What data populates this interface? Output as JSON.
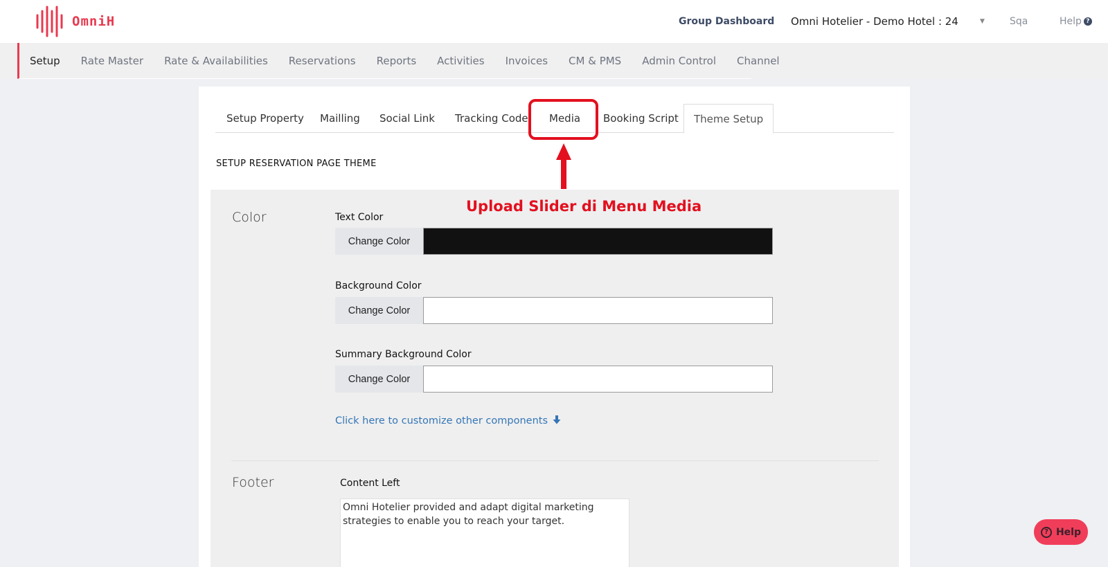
{
  "header": {
    "logo_text": "OmniH",
    "group_dashboard": "Group Dashboard",
    "hotel_selector": "Omni Hotelier - Demo Hotel : 24",
    "caret": "▼",
    "user": "Sqa",
    "help": "Help",
    "help_icon": "question-circle-icon"
  },
  "mainnav": {
    "items": [
      "Setup",
      "Rate Master",
      "Rate & Availabilities",
      "Reservations",
      "Reports",
      "Activities",
      "Invoices",
      "CM & PMS",
      "Admin Control",
      "Channel"
    ],
    "active": "Setup"
  },
  "tabs": {
    "items": [
      "Setup Property",
      "Mailling",
      "Social Link",
      "Tracking Code",
      "Media",
      "Booking Script",
      "Theme Setup"
    ],
    "active": "Theme Setup"
  },
  "page": {
    "section_title": "SETUP RESERVATION PAGE THEME"
  },
  "color_section": {
    "label": "Color",
    "fields": [
      {
        "label": "Text Color",
        "button": "Change Color",
        "value_color": "#111111"
      },
      {
        "label": "Background Color",
        "button": "Change Color",
        "value_color": "#ffffff"
      },
      {
        "label": "Summary Background Color",
        "button": "Change Color",
        "value_color": "#ffffff"
      }
    ],
    "customize_link": "Click here to customize other components",
    "customize_icon": "arrow-down-icon"
  },
  "footer_section": {
    "label": "Footer",
    "content_left_label": "Content Left",
    "content_left_value": "Omni Hotelier provided and adapt digital marketing strategies to enable you to reach your target."
  },
  "annotation": {
    "text": "Upload Slider di Menu Media",
    "color": "#e3101f"
  },
  "floating_help": {
    "label": "Help",
    "icon": "question-circle-icon"
  },
  "colors": {
    "brand": "#e8394f",
    "link": "#3476b6",
    "header_accent": "#3d4b66"
  }
}
